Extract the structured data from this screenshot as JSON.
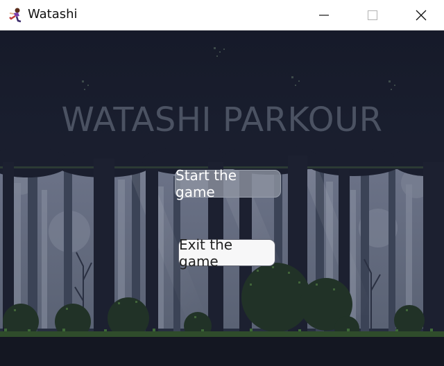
{
  "window": {
    "title": "Watashi",
    "icon": "running-character-icon",
    "controls": [
      "minimize-icon",
      "maximize-icon",
      "close-icon"
    ]
  },
  "game": {
    "title": "WATASHI PARKOUR",
    "menu": {
      "start_label": "Start the game",
      "exit_label": "Exit the game"
    },
    "background": "pixel-art night forest",
    "colors": {
      "sky": "#171b2b",
      "title_text": "#4b5262",
      "grass": "#2f4c2b"
    }
  }
}
